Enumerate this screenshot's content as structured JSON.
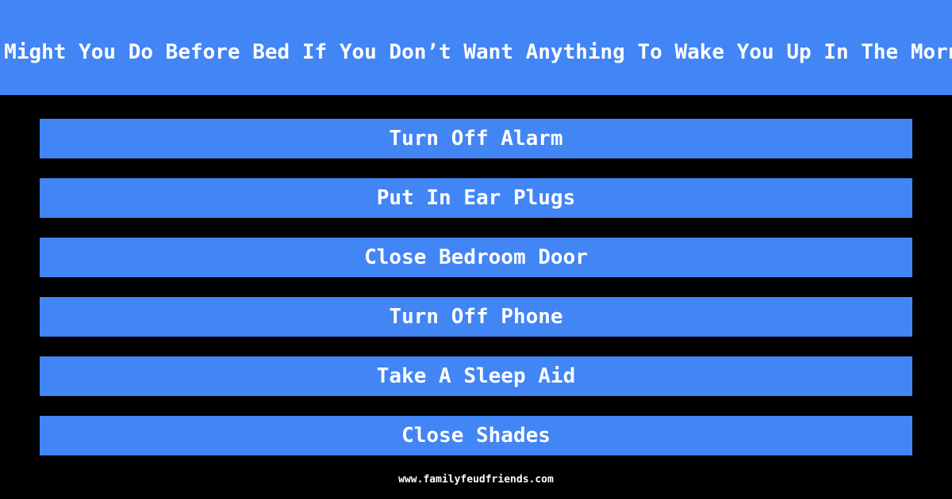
{
  "header": {
    "title": "What Might You Do Before Bed If You Don’t Want Anything To Wake You Up In The Morning?"
  },
  "answers": [
    {
      "label": "Turn Off Alarm"
    },
    {
      "label": "Put In Ear Plugs"
    },
    {
      "label": "Close Bedroom Door"
    },
    {
      "label": "Turn Off Phone"
    },
    {
      "label": "Take A Sleep Aid"
    },
    {
      "label": "Close Shades"
    }
  ],
  "footer": {
    "url": "www.familyfeudfriends.com"
  },
  "colors": {
    "accent": "#4285f4",
    "background": "#000000",
    "text": "#ffffff"
  }
}
